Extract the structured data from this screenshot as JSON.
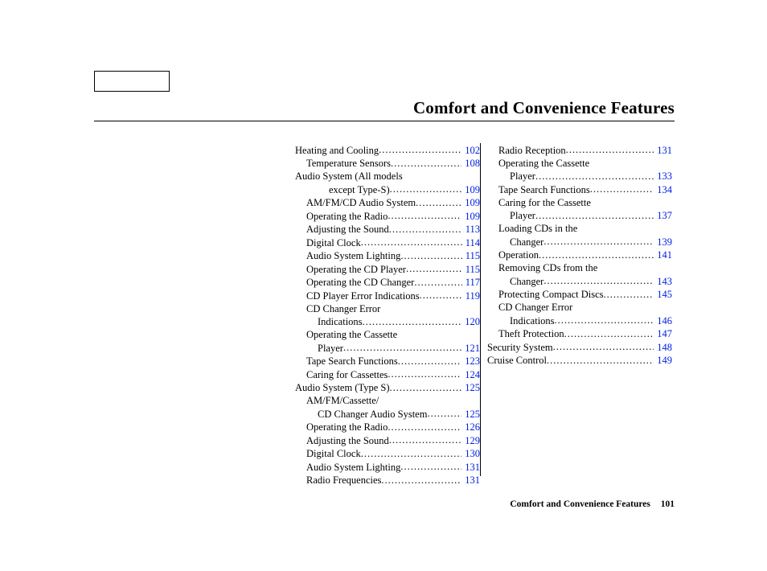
{
  "title": "Comfort and Convenience Features",
  "footer": {
    "text": "Comfort and Convenience Features",
    "page": "101"
  },
  "columns": [
    {
      "lines": [
        {
          "indent": 0,
          "label": "Heating and Cooling",
          "page": "102"
        },
        {
          "indent": 1,
          "label": "Temperature Sensors",
          "page": "108"
        },
        {
          "indent": 0,
          "label": "Audio System (All models"
        },
        {
          "indent": 3,
          "label": "except Type-S)",
          "page": "109"
        },
        {
          "indent": 1,
          "label": "AM/FM/CD Audio System",
          "page": "109"
        },
        {
          "indent": 1,
          "label": "Operating the Radio",
          "page": "109"
        },
        {
          "indent": 1,
          "label": "Adjusting the Sound",
          "page": "113"
        },
        {
          "indent": 1,
          "label": "Digital Clock",
          "page": "114"
        },
        {
          "indent": 1,
          "label": "Audio System Lighting",
          "page": "115"
        },
        {
          "indent": 1,
          "label": "Operating the CD Player",
          "page": "115"
        },
        {
          "indent": 1,
          "label": "Operating the CD Changer",
          "page": "117"
        },
        {
          "indent": 1,
          "label": "CD Player Error Indications",
          "page": "119"
        },
        {
          "indent": 1,
          "label": "CD Changer Error"
        },
        {
          "indent": 2,
          "label": "Indications",
          "page": "120"
        },
        {
          "indent": 1,
          "label": "Operating the Cassette"
        },
        {
          "indent": 2,
          "label": "Player",
          "page": "121"
        },
        {
          "indent": 1,
          "label": "Tape Search Functions",
          "page": "123"
        },
        {
          "indent": 1,
          "label": "Caring for Cassettes",
          "page": "124"
        },
        {
          "indent": 0,
          "label": "Audio System (Type S)",
          "page": "125"
        },
        {
          "indent": 1,
          "label": "AM/FM/Cassette/"
        },
        {
          "indent": 2,
          "label": "CD Changer Audio System",
          "page": "125"
        },
        {
          "indent": 1,
          "label": "Operating the Radio",
          "page": "126"
        },
        {
          "indent": 1,
          "label": "Adjusting the Sound",
          "page": "129"
        },
        {
          "indent": 1,
          "label": "Digital Clock",
          "page": "130"
        },
        {
          "indent": 1,
          "label": "Audio System Lighting",
          "page": "131"
        },
        {
          "indent": 1,
          "label": "Radio Frequencies",
          "page": "131"
        }
      ]
    },
    {
      "lines": [
        {
          "indent": 1,
          "label": "Radio Reception",
          "page": "131"
        },
        {
          "indent": 1,
          "label": "Operating the Cassette"
        },
        {
          "indent": 2,
          "label": "Player",
          "page": "133"
        },
        {
          "indent": 1,
          "label": "Tape Search Functions",
          "page": "134"
        },
        {
          "indent": 1,
          "label": "Caring for the Cassette"
        },
        {
          "indent": 2,
          "label": "Player",
          "page": "137"
        },
        {
          "indent": 1,
          "label": "Loading CDs in the"
        },
        {
          "indent": 2,
          "label": "Changer",
          "page": "139"
        },
        {
          "indent": 1,
          "label": "Operation",
          "page": "141"
        },
        {
          "indent": 1,
          "label": "Removing CDs from the"
        },
        {
          "indent": 2,
          "label": "Changer",
          "page": "143"
        },
        {
          "indent": 1,
          "label": "Protecting Compact Discs",
          "page": "145"
        },
        {
          "indent": 1,
          "label": "CD Changer Error"
        },
        {
          "indent": 2,
          "label": "Indications",
          "page": "146"
        },
        {
          "indent": 1,
          "label": "Theft Protection",
          "page": "147"
        },
        {
          "indent": 0,
          "label": "Security System",
          "page": "148"
        },
        {
          "indent": 0,
          "label": "Cruise Control",
          "page": "149"
        }
      ]
    }
  ]
}
